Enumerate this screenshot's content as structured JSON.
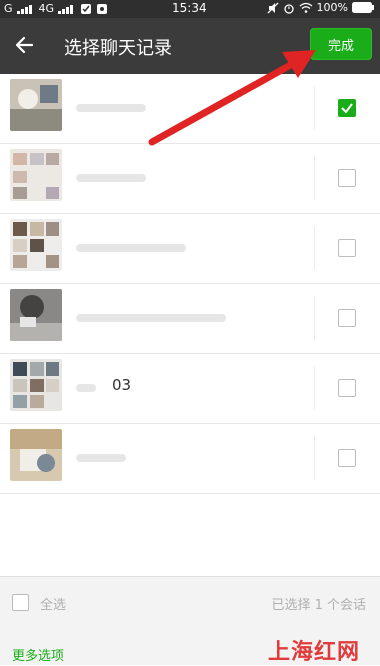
{
  "status_bar": {
    "carrier_left": "G",
    "network": "4G",
    "time": "15:34",
    "battery": "100%"
  },
  "header": {
    "title": "选择聊天记录",
    "done_label": "完成"
  },
  "chats": [
    {
      "name": "",
      "checked": true
    },
    {
      "name": "",
      "checked": false
    },
    {
      "name": "",
      "checked": false
    },
    {
      "name": "",
      "checked": false
    },
    {
      "name": "03",
      "checked": false
    },
    {
      "name": "",
      "checked": false
    }
  ],
  "footer": {
    "select_all_label": "全选",
    "selected_count": "已选择 1 个会话",
    "more_options": "更多选项"
  },
  "watermark": "上海红网",
  "colors": {
    "accent": "#1aad19",
    "appbar": "#3b3b3b",
    "statusbar": "#2f2f2f",
    "arrow": "#e02424"
  }
}
